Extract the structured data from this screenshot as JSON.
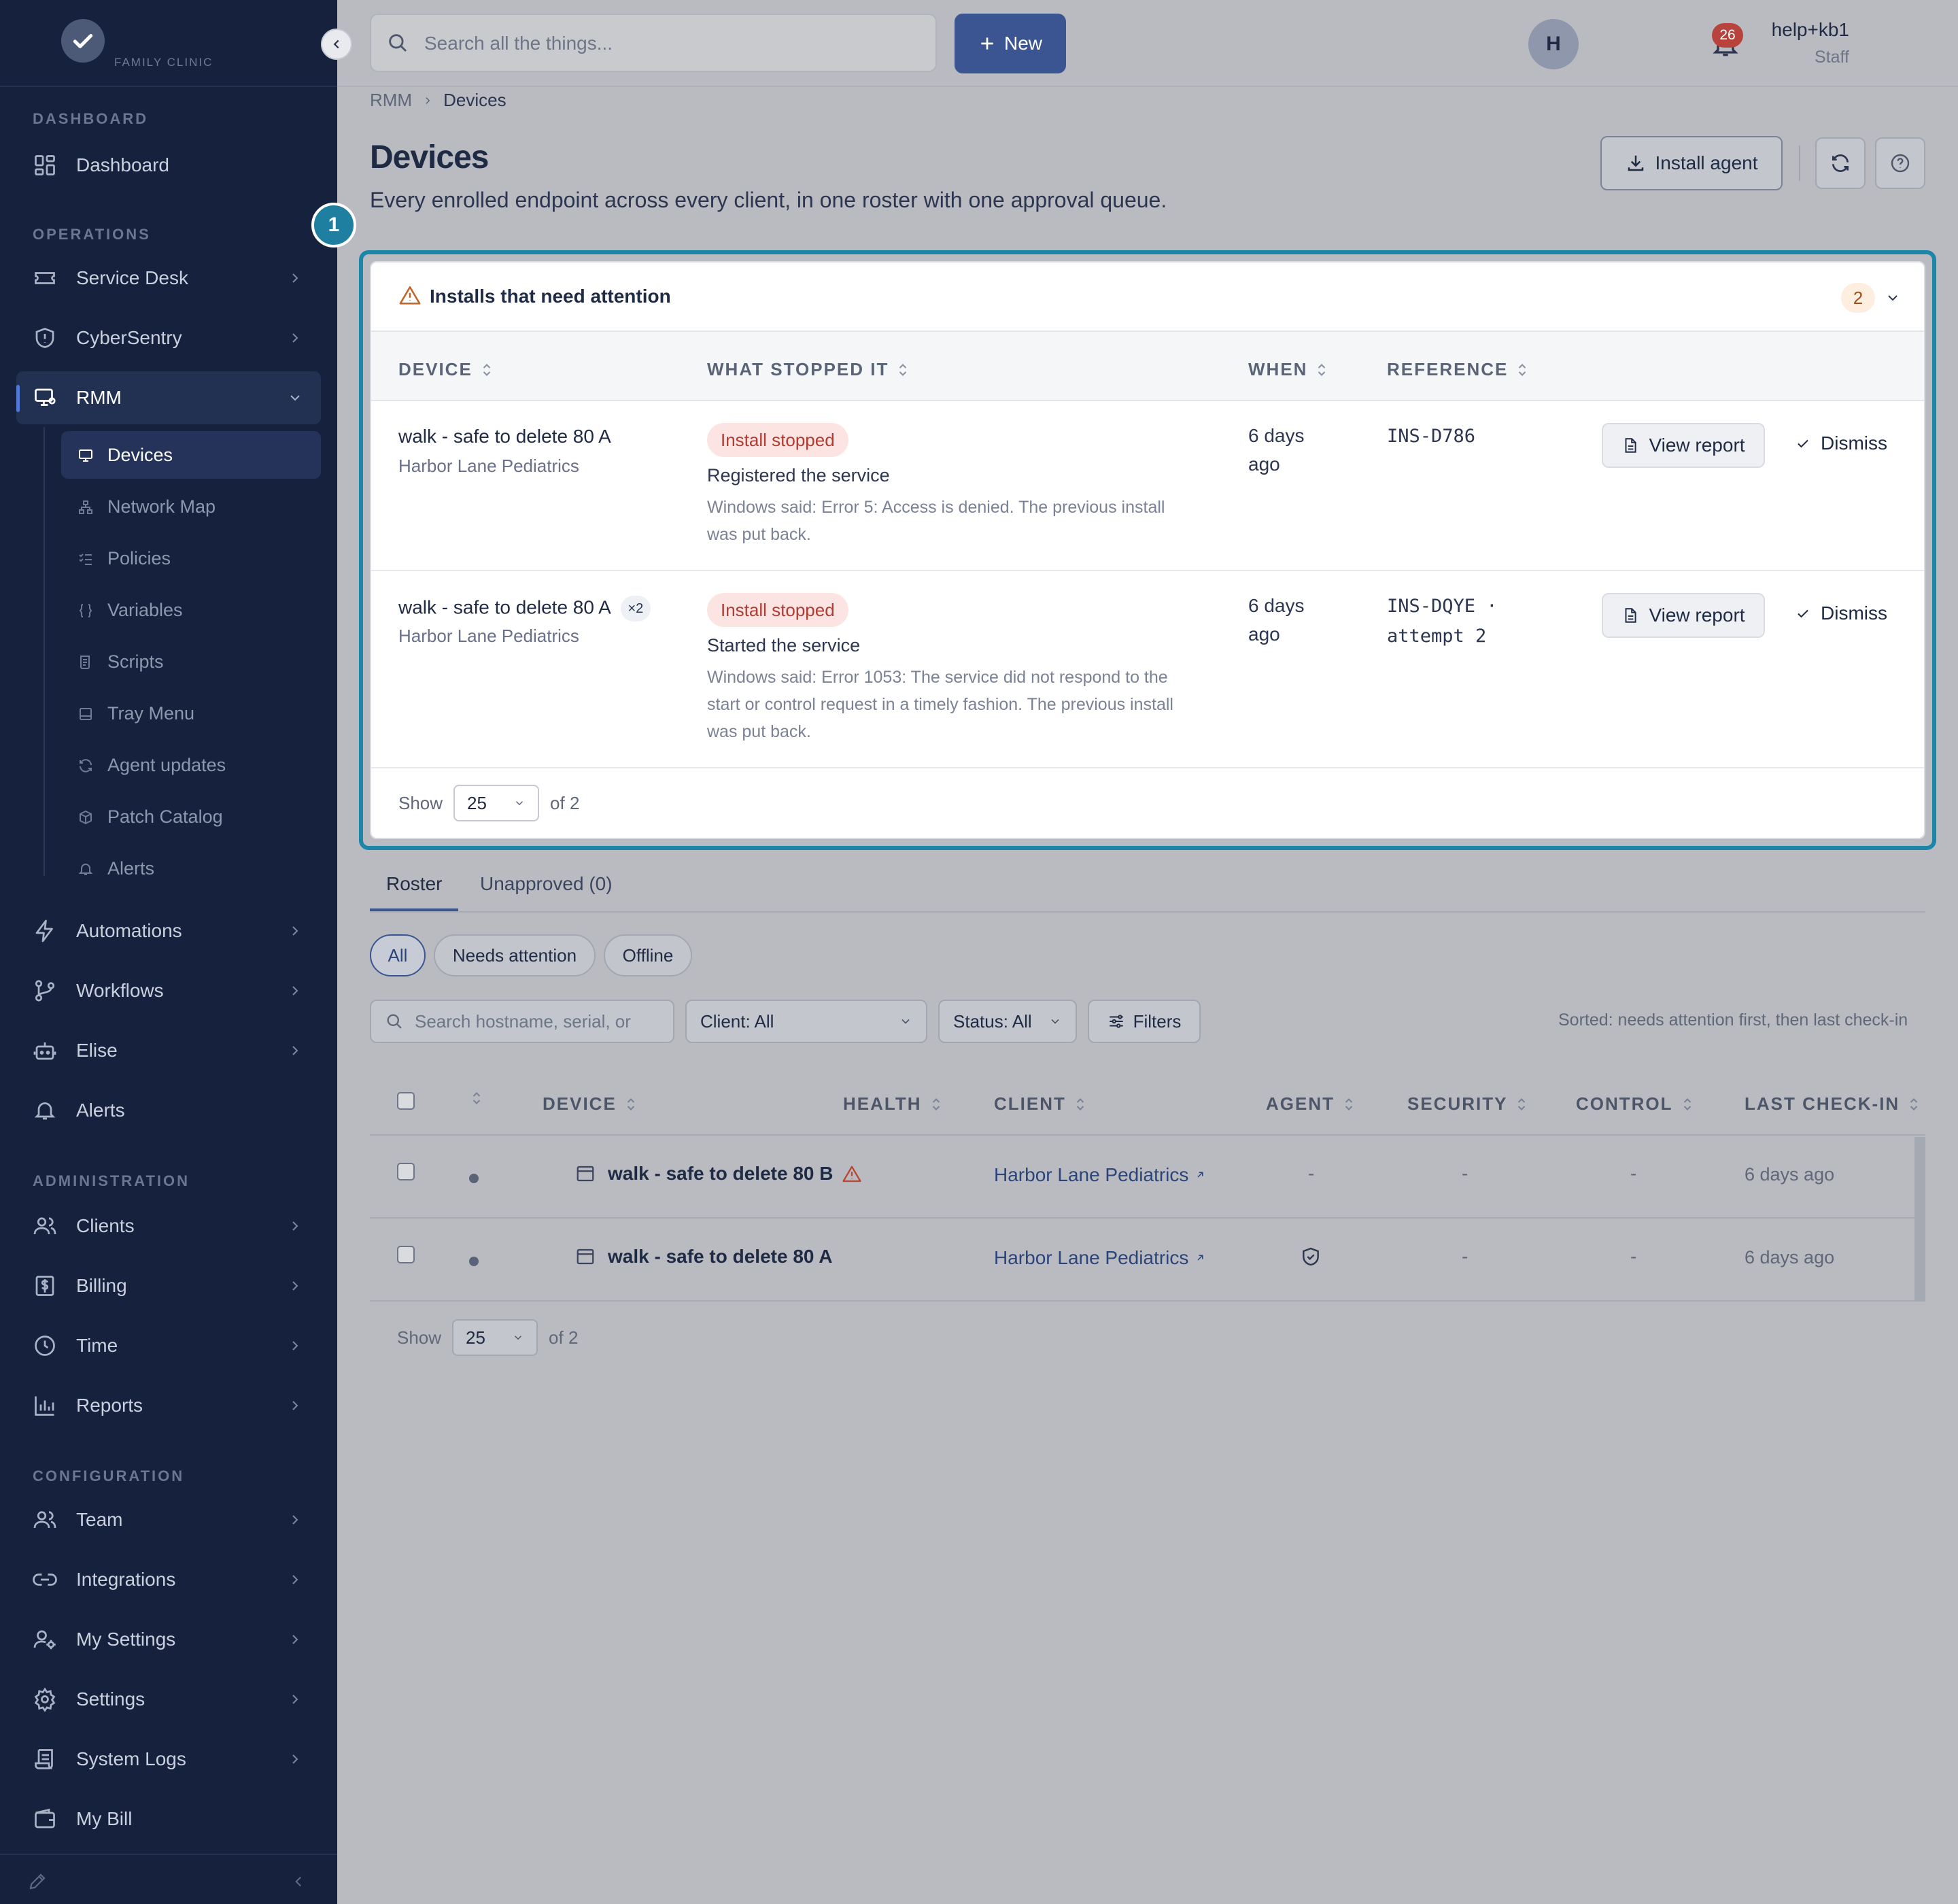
{
  "brand": {
    "name": "FAMILY CLINIC"
  },
  "sidebar": {
    "sections": {
      "dashboard": "DASHBOARD",
      "operations": "OPERATIONS",
      "administration": "ADMINISTRATION",
      "configuration": "CONFIGURATION"
    },
    "items": {
      "dashboard": "Dashboard",
      "service_desk": "Service Desk",
      "cybersentry": "CyberSentry",
      "rmm": "RMM",
      "automations": "Automations",
      "workflows": "Workflows",
      "elise": "Elise",
      "alerts": "Alerts",
      "clients": "Clients",
      "billing": "Billing",
      "time": "Time",
      "reports": "Reports",
      "team": "Team",
      "integrations": "Integrations",
      "my_settings": "My Settings",
      "settings": "Settings",
      "system_logs": "System Logs",
      "my_bill": "My Bill"
    },
    "rmm_sub": {
      "devices": "Devices",
      "network_map": "Network Map",
      "policies": "Policies",
      "variables": "Variables",
      "scripts": "Scripts",
      "tray_menu": "Tray Menu",
      "agent_updates": "Agent updates",
      "patch_catalog": "Patch Catalog",
      "alerts": "Alerts"
    }
  },
  "topbar": {
    "search_placeholder": "Search all the things...",
    "new_label": "New",
    "notifications": "26",
    "user_name": "help+kb1",
    "user_role": "Staff",
    "avatar_initial": "H"
  },
  "breadcrumb": {
    "parent": "RMM",
    "current": "Devices"
  },
  "page": {
    "title": "Devices",
    "subtitle": "Every enrolled endpoint across every client, in one roster with one approval queue.",
    "install_agent": "Install agent",
    "step_number": "1"
  },
  "attention": {
    "title": "Installs that need attention",
    "count": "2",
    "columns": {
      "device": "DEVICE",
      "what": "WHAT STOPPED IT",
      "when": "WHEN",
      "reference": "REFERENCE"
    },
    "rows": [
      {
        "device": "walk - safe to delete 80 A",
        "multiplier": "",
        "client": "Harbor Lane Pediatrics",
        "status": "Install stopped",
        "stage": "Registered the service",
        "detail": "Windows said: Error 5: Access is denied. The previous install was put back.",
        "when": "6 days ago",
        "reference": "INS-D786",
        "view_report": "View report",
        "dismiss": "Dismiss"
      },
      {
        "device": "walk - safe to delete 80 A",
        "multiplier": "×2",
        "client": "Harbor Lane Pediatrics",
        "status": "Install stopped",
        "stage": "Started the service",
        "detail": "Windows said: Error 1053: The service did not respond to the start or control request in a timely fashion. The previous install was put back.",
        "when": "6 days ago",
        "reference": "INS-DQYE · attempt 2",
        "view_report": "View report",
        "dismiss": "Dismiss"
      }
    ],
    "pager": {
      "show": "Show",
      "size": "25",
      "of": "of 2"
    }
  },
  "tabs": {
    "roster": "Roster",
    "unapproved": "Unapproved (0)"
  },
  "chips": {
    "all": "All",
    "needs_attention": "Needs attention",
    "offline": "Offline"
  },
  "filters": {
    "search_placeholder": "Search hostname, serial, or",
    "client": "Client: All",
    "status": "Status: All",
    "filters": "Filters",
    "sort_note": "Sorted: needs attention first, then last check-in"
  },
  "roster": {
    "columns": {
      "device": "DEVICE",
      "health": "HEALTH",
      "client": "CLIENT",
      "agent": "AGENT",
      "security": "SECURITY",
      "control": "CONTROL",
      "last_checkin": "LAST CHECK-IN"
    },
    "rows": [
      {
        "device": "walk - safe to delete 80 B",
        "health": "warning",
        "client": "Harbor Lane Pediatrics",
        "agent": "-",
        "security": "-",
        "control": "-",
        "last_checkin": "6 days ago"
      },
      {
        "device": "walk - safe to delete 80 A",
        "health": "",
        "client": "Harbor Lane Pediatrics",
        "agent": "shield",
        "security": "-",
        "control": "-",
        "last_checkin": "6 days ago"
      }
    ],
    "pager": {
      "show": "Show",
      "size": "25",
      "of": "of 2"
    }
  }
}
